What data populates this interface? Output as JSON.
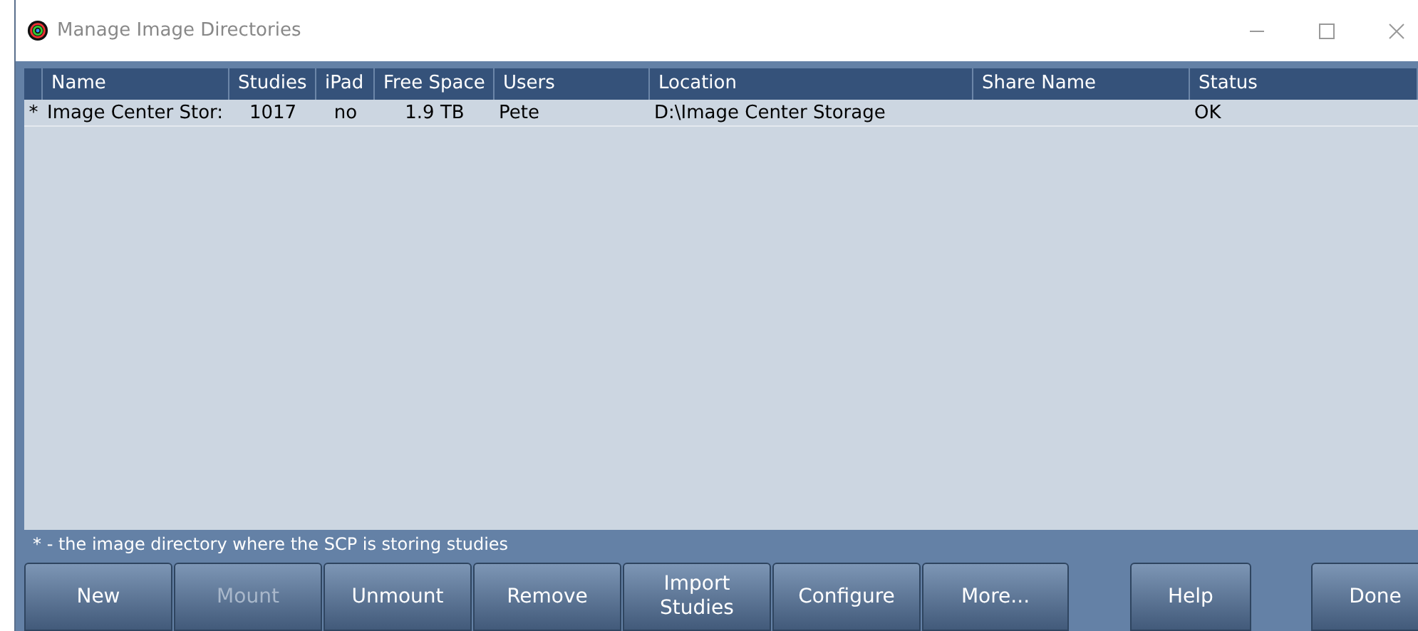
{
  "window": {
    "title": "Manage Image Directories"
  },
  "table": {
    "columns": [
      "Name",
      "Studies",
      "iPad",
      "Free Space",
      "Users",
      "Location",
      "Share Name",
      "Status"
    ],
    "rows": [
      {
        "marker": "*",
        "cells": [
          "Image Center Stor:",
          "1017",
          "no",
          "1.9 TB",
          "Pete",
          "D:\\Image Center Storage",
          "",
          "OK"
        ]
      }
    ]
  },
  "note": "* - the image directory where the SCP is storing studies",
  "buttons": [
    {
      "label": "New",
      "disabled": false
    },
    {
      "label": "Mount",
      "disabled": true
    },
    {
      "label": "Unmount",
      "disabled": false
    },
    {
      "label": "Remove",
      "disabled": false
    },
    {
      "label": "Import Studies",
      "disabled": false
    },
    {
      "label": "Configure",
      "disabled": false
    },
    {
      "label": "More...",
      "disabled": false
    }
  ],
  "side_buttons": [
    {
      "label": "Help"
    },
    {
      "label": "Done"
    }
  ]
}
